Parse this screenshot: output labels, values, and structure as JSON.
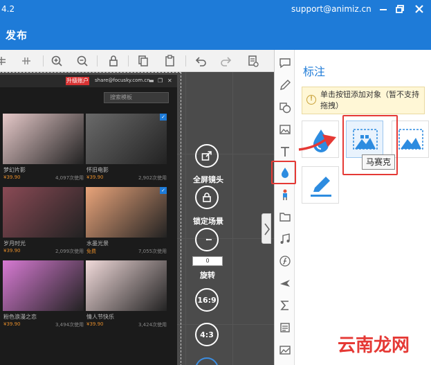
{
  "window": {
    "version": "4.2",
    "email": "support@animiz.cn"
  },
  "menu": {
    "publish_label": "发布"
  },
  "inner_app": {
    "badge": "升级账户",
    "account": "share@focusky.com.cn",
    "search_placeholder": "搜索模板",
    "items": [
      {
        "title": "梦幻片影",
        "price": "¥39.90",
        "count": "4,097次使用",
        "color": "#e6c9c9"
      },
      {
        "title": "怀旧电影",
        "price": "¥39.90",
        "count": "2,902次使用",
        "color": "#6a6a6a"
      },
      {
        "title": "岁月时光",
        "price": "¥39.90",
        "count": "2,099次使用",
        "color": "#8a4a55"
      },
      {
        "title": "水墨光景",
        "price": "免费",
        "count": "7,055次使用",
        "color": "#e9a47a"
      },
      {
        "title": "粉色浪漫之恋",
        "price": "¥39.90",
        "count": "3,494次使用",
        "color": "#d77ad3"
      },
      {
        "title": "情人节快乐",
        "price": "¥39.90",
        "count": "3,424次使用",
        "color": "#f1dada"
      }
    ]
  },
  "controls": {
    "fullscreen_label": "全屏镜头",
    "lock_label": "锁定场景",
    "rotate_value": "0",
    "rotate_label": "旋转",
    "ratio_16_9": "16:9",
    "ratio_4_3": "4:3"
  },
  "panel": {
    "title": "标注",
    "hint": "单击按钮添加对象（暂不支持拖拽）",
    "tooltip": "马赛克"
  },
  "watermark": "云南龙网",
  "colors": {
    "accent": "#1e7bd8",
    "highlight": "#e53935"
  }
}
